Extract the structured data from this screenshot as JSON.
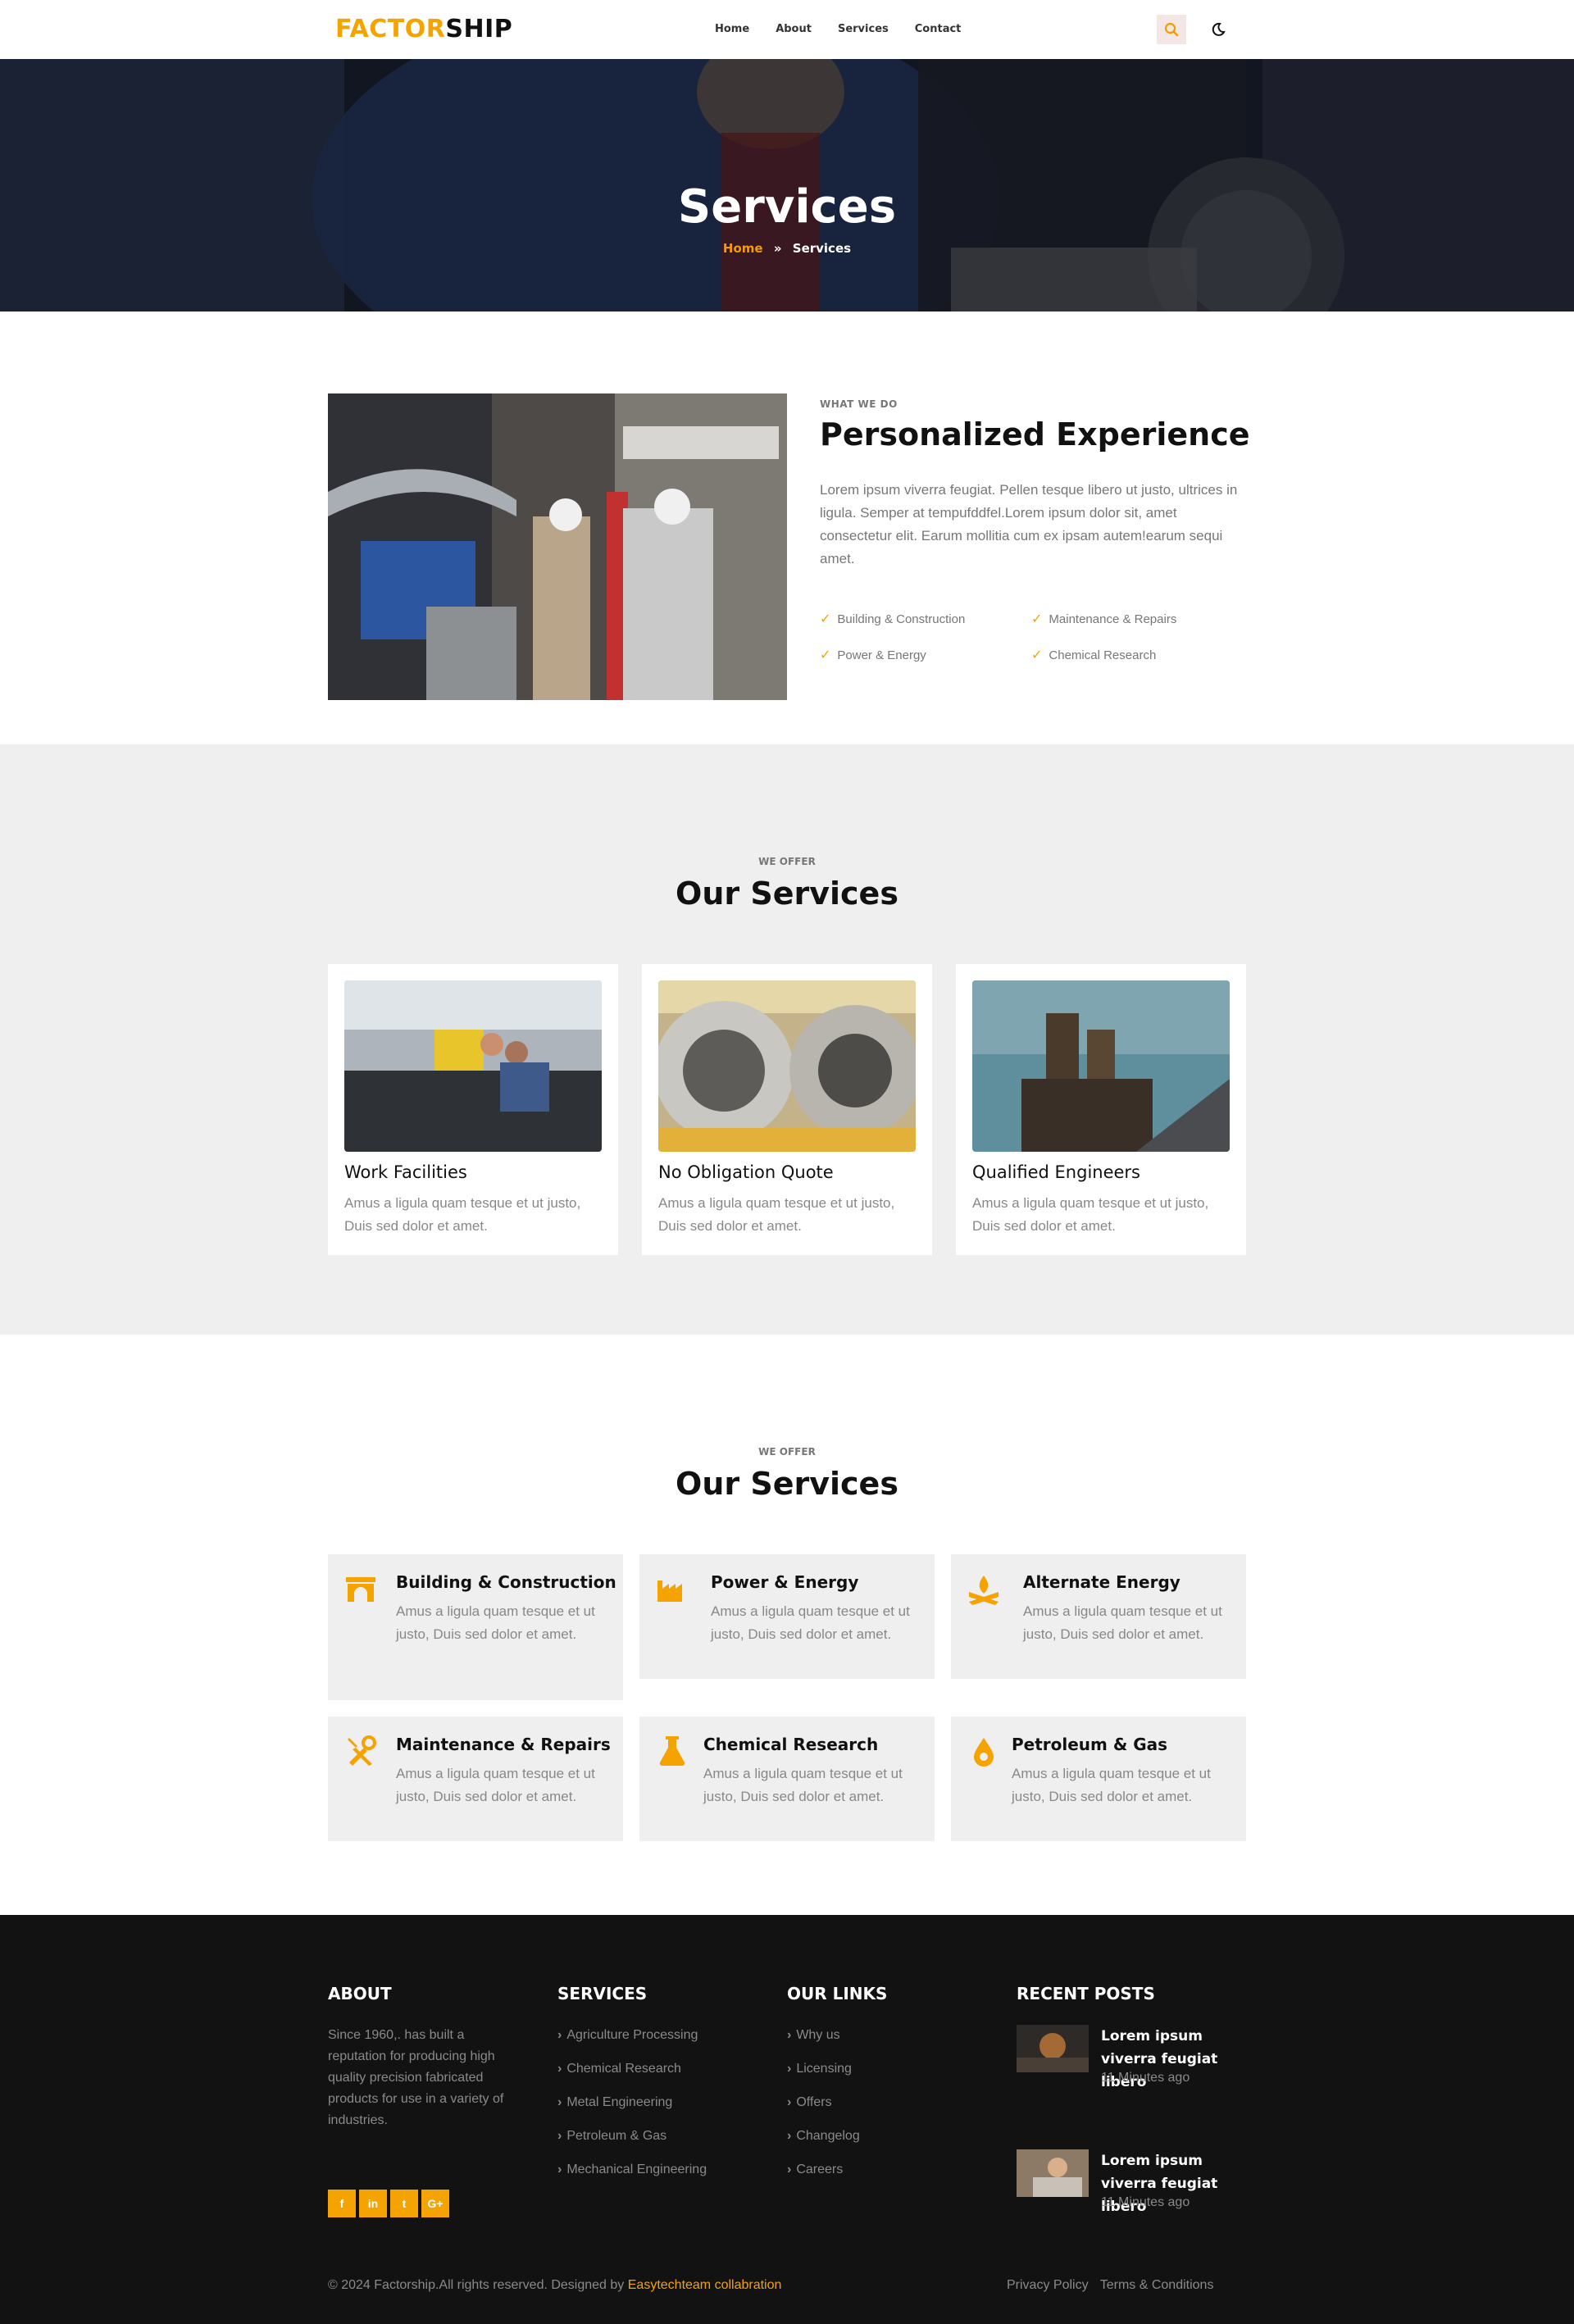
{
  "header": {
    "logo_part1": "FACTOR",
    "logo_part2": "SHIP",
    "nav": [
      "Home",
      "About",
      "Services",
      "Contact"
    ],
    "search_icon": "search-icon",
    "theme_icon": "moon-icon"
  },
  "hero": {
    "title": "Services",
    "breadcrumb_home": "Home",
    "breadcrumb_current": "Services"
  },
  "about": {
    "tag": "WHAT WE DO",
    "title": "Personalized Experience",
    "text": "Lorem ipsum viverra feugiat. Pellen tesque libero ut justo, ultrices in ligula. Semper at tempufddfel.Lorem ipsum dolor sit, amet consectetur elit. Earum mollitia cum ex ipsam autem!earum sequi amet.",
    "checks": [
      "Building & Construction",
      "Maintenance & Repairs",
      "Power & Energy",
      "Chemical Research"
    ]
  },
  "services_cards": {
    "tag": "WE OFFER",
    "title": "Our Services",
    "cards": [
      {
        "title": "Work Facilities",
        "text": "Amus a ligula quam tesque et ut justo, Duis sed dolor et amet."
      },
      {
        "title": "No Obligation Quote",
        "text": "Amus a ligula quam tesque et ut justo, Duis sed dolor et amet."
      },
      {
        "title": "Qualified Engineers",
        "text": "Amus a ligula quam tesque et ut justo, Duis sed dolor et amet."
      }
    ]
  },
  "services_icons": {
    "tag": "WE OFFER",
    "title": "Our Services",
    "items": [
      {
        "title": "Building & Construction",
        "text": "Amus a ligula quam tesque et ut justo, Duis sed dolor et amet.",
        "icon": "archway-icon"
      },
      {
        "title": "Power & Energy",
        "text": "Amus a ligula quam tesque et ut justo, Duis sed dolor et amet.",
        "icon": "industry-icon"
      },
      {
        "title": "Alternate Energy",
        "text": "Amus a ligula quam tesque et ut justo, Duis sed dolor et amet.",
        "icon": "campfire-icon"
      },
      {
        "title": "Maintenance & Repairs",
        "text": "Amus a ligula quam tesque et ut justo, Duis sed dolor et amet.",
        "icon": "tools-icon"
      },
      {
        "title": "Chemical Research",
        "text": "Amus a ligula quam tesque et ut justo, Duis sed dolor et amet.",
        "icon": "flask-icon"
      },
      {
        "title": "Petroleum & Gas",
        "text": "Amus a ligula quam tesque et ut justo, Duis sed dolor et amet.",
        "icon": "oil-drop-icon"
      }
    ]
  },
  "footer": {
    "about_heading": "ABOUT",
    "about_text": "Since 1960,. has built a reputation for producing high quality precision fabricated products for use in a variety of industries.",
    "services_heading": "SERVICES",
    "services_links": [
      "Agriculture Processing",
      "Chemical Research",
      "Metal Engineering",
      "Petroleum & Gas",
      "Mechanical Engineering"
    ],
    "links_heading": "OUR LINKS",
    "links": [
      "Why us",
      "Licensing",
      "Offers",
      "Changelog",
      "Careers"
    ],
    "posts_heading": "RECENT POSTS",
    "posts": [
      {
        "title": "Lorem ipsum viverra feugiat libero",
        "time": "11 Minutes ago"
      },
      {
        "title": "Lorem ipsum viverra feugiat libero",
        "time": "11 Minutes ago"
      }
    ],
    "socials": [
      "f",
      "in",
      "t",
      "G+"
    ],
    "copyright": "© 2024 Factorship.All rights reserved. Designed by ",
    "designer": "Easytechteam collabration",
    "legal": [
      "Privacy Policy",
      "Terms & Conditions"
    ]
  },
  "colors": {
    "accent": "#f5a300",
    "dark": "#121212",
    "gray_bg": "#efefef"
  }
}
